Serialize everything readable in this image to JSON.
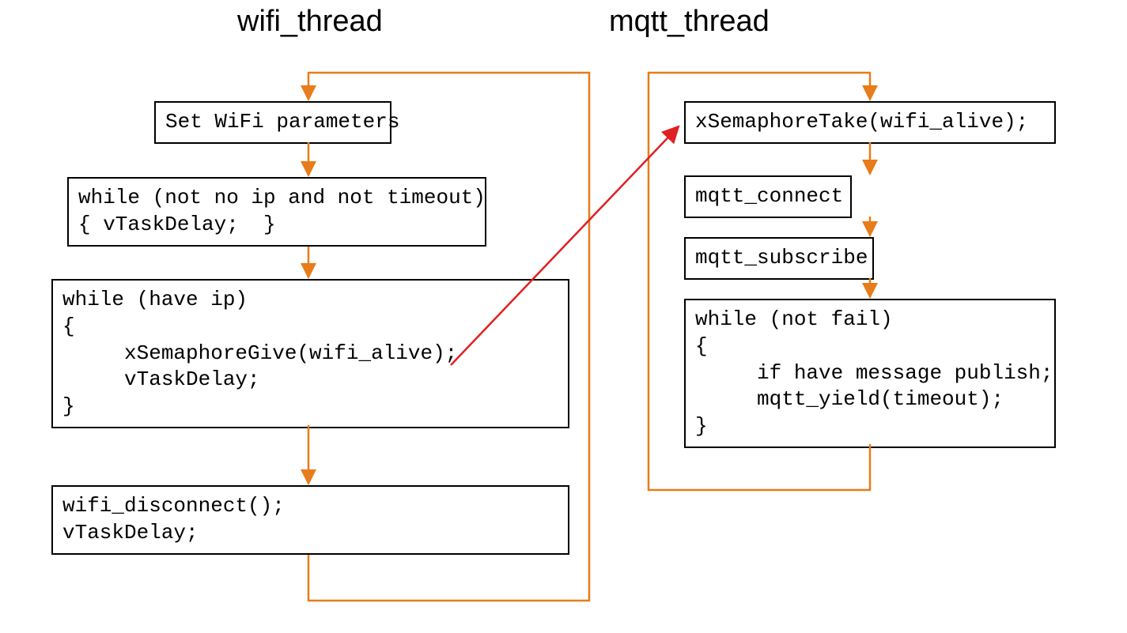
{
  "titles": {
    "left": "wifi_thread",
    "right": "mqtt_thread"
  },
  "wifi": {
    "box1": "Set WiFi parameters",
    "box2": "while (not no ip and not timeout)\n{ vTaskDelay;  }",
    "box3": "while (have ip)\n{\n     xSemaphoreGive(wifi_alive);\n     vTaskDelay;\n}",
    "box4": "wifi_disconnect();\nvTaskDelay;"
  },
  "mqtt": {
    "box1": "xSemaphoreTake(wifi_alive);",
    "box2": "mqtt_connect",
    "box3": "mqtt_subscribe",
    "box4": "while (not fail)\n{\n     if have message publish;\n     mqtt_yield(timeout);\n}"
  },
  "colors": {
    "arrow": "#E87B1A",
    "cross": "#E02020"
  }
}
